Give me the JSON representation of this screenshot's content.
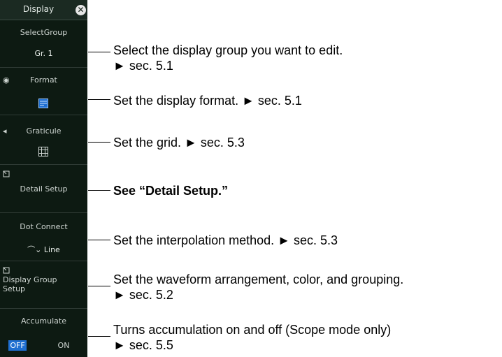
{
  "panel": {
    "title": "Display",
    "close_icon": "close-icon",
    "select_group": {
      "label": "SelectGroup",
      "value": "Gr. 1"
    },
    "format": {
      "label": "Format",
      "icon": "format-icon"
    },
    "graticule": {
      "label": "Graticule",
      "icon": "grid-icon"
    },
    "detail_setup": {
      "label": "Detail Setup"
    },
    "dot_connect": {
      "label": "Dot Connect",
      "value": "Line"
    },
    "display_group_setup": {
      "label_line1": "Display Group",
      "label_line2": "Setup"
    },
    "accumulate": {
      "label": "Accumulate",
      "off": "OFF",
      "on": "ON",
      "selected": "OFF"
    }
  },
  "annotations": {
    "select_group": {
      "line1": "Select the display group you want to edit.",
      "line2": "► sec. 5.1"
    },
    "format": {
      "line1": "Set the display format. ► sec. 5.1"
    },
    "graticule": {
      "line1": "Set the grid. ► sec. 5.3"
    },
    "detail_setup": {
      "line1": "See “Detail Setup.”"
    },
    "dot_connect": {
      "line1": "Set the interpolation method. ► sec. 5.3"
    },
    "display_group_setup": {
      "line1": "Set the waveform arrangement, color, and grouping.",
      "line2": "► sec. 5.2"
    },
    "accumulate": {
      "line1": "Turns accumulation on and off (Scope mode only)",
      "line2": "► sec. 5.5"
    }
  }
}
